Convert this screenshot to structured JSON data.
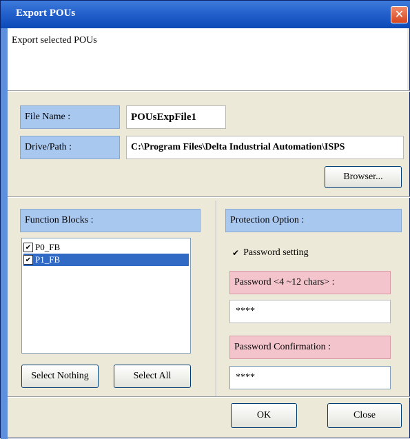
{
  "window": {
    "title": "Export POUs",
    "description": "Export selected POUs"
  },
  "file": {
    "name_label": "File Name :",
    "name_value": "POUsExpFile1",
    "path_label": "Drive/Path :",
    "path_value": "C:\\Program Files\\Delta Industrial Automation\\ISPS",
    "browse_label": "Browser..."
  },
  "function_blocks": {
    "label": "Function Blocks :",
    "items": [
      {
        "label": "P0_FB",
        "checked": true,
        "selected": false
      },
      {
        "label": "P1_FB",
        "checked": true,
        "selected": true
      }
    ],
    "select_nothing_label": "Select Nothing",
    "select_all_label": "Select All"
  },
  "protection": {
    "label": "Protection Option :",
    "password_setting_label": "Password setting",
    "password_setting_checked": true,
    "password_label": "Password <4 ~12 chars> :",
    "password_value": "****",
    "confirm_label": "Password Confirmation :",
    "confirm_value": "****"
  },
  "footer": {
    "ok_label": "OK",
    "close_label": "Close"
  },
  "colors": {
    "title_bar": "#2461cc",
    "label_blue": "#a9c8f0",
    "label_pink": "#f3c4cc",
    "selection": "#316ac5",
    "dialog_bg": "#ece9d8"
  }
}
